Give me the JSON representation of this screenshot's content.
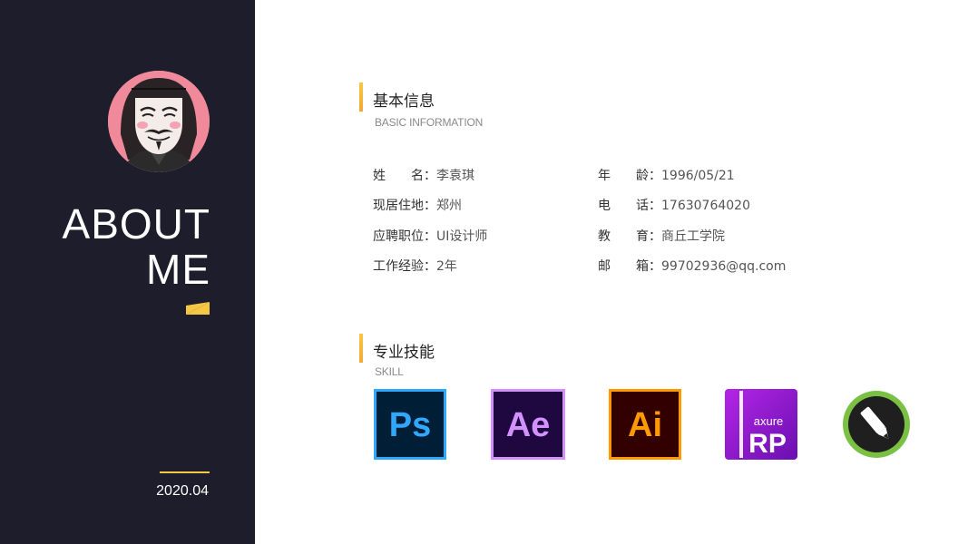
{
  "sidebar": {
    "title_line1": "ABOUT",
    "title_line2": "ME",
    "date": "2020.04",
    "accent_color": "#f6c744",
    "background_color": "#1d1d2b"
  },
  "basic_info": {
    "title": "基本信息",
    "subtitle": "BASIC INFORMATION",
    "left": [
      {
        "key": "姓　　名：",
        "value": "李袁琪"
      },
      {
        "key": "现居住地：",
        "value": "郑州"
      },
      {
        "key": "应聘职位：",
        "value": "UI设计师"
      },
      {
        "key": "工作经验：",
        "value": "2年"
      }
    ],
    "right": [
      {
        "key": "年　　龄：",
        "value": "1996/05/21"
      },
      {
        "key": "电　　话：",
        "value": "17630764020"
      },
      {
        "key": "教　　育：",
        "value": "商丘工学院"
      },
      {
        "key": "邮　　箱：",
        "value": "99702936@qq.com"
      }
    ]
  },
  "skills": {
    "title": "专业技能",
    "subtitle": "SKILL",
    "items": [
      {
        "icon": "photoshop-icon",
        "label": "Ps",
        "color": "#31a8ff",
        "bg": "#001e36"
      },
      {
        "icon": "after-effects-icon",
        "label": "Ae",
        "color": "#d291ff",
        "bg": "#1f0740"
      },
      {
        "icon": "illustrator-icon",
        "label": "Ai",
        "color": "#ff9a00",
        "bg": "#330000"
      },
      {
        "icon": "axure-rp-icon",
        "label_small": "axure",
        "label": "RP",
        "color": "#ffffff",
        "bg": "#9b1fd1"
      },
      {
        "icon": "coreldraw-icon",
        "color": "#7ac143",
        "bg": "#1f1f1f"
      }
    ]
  }
}
